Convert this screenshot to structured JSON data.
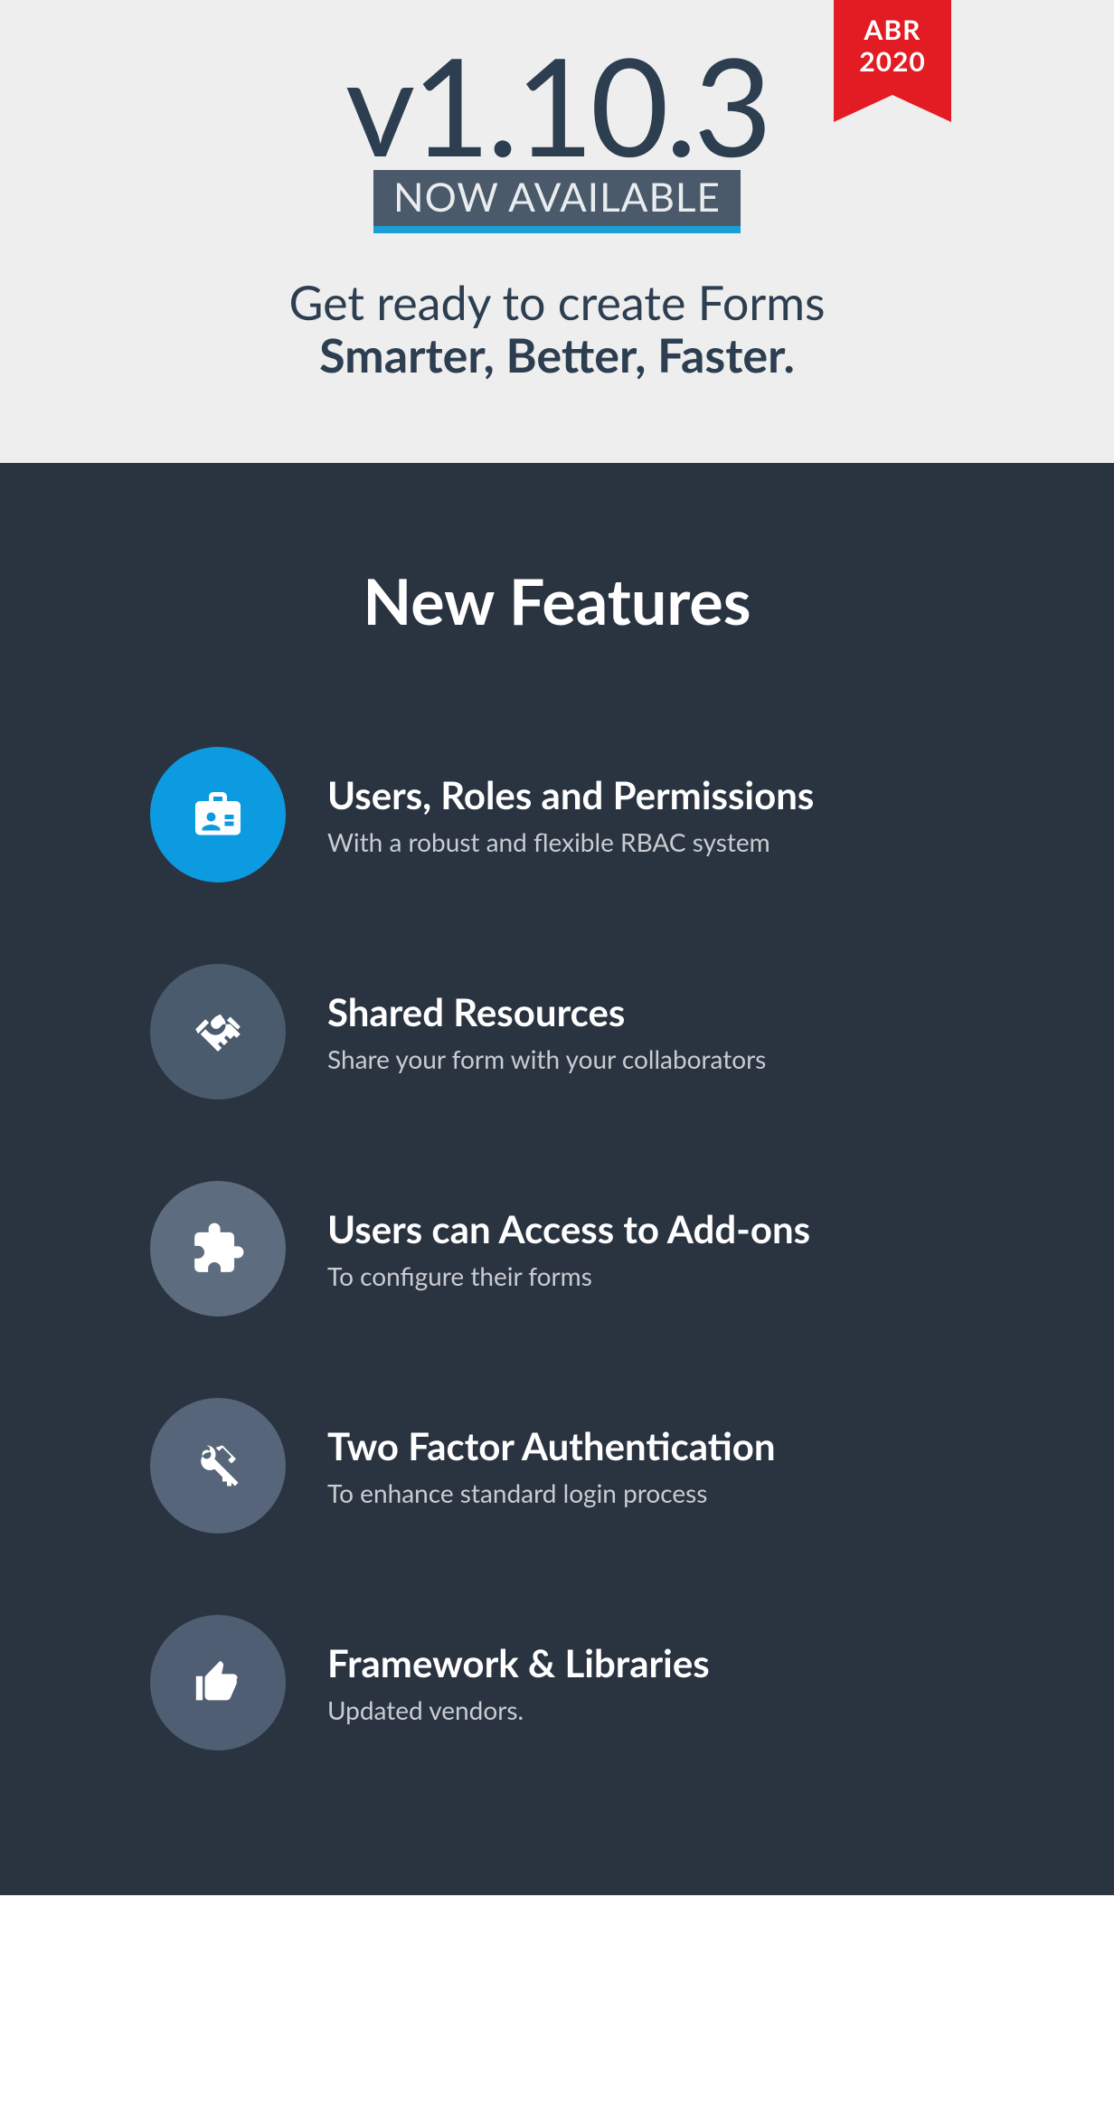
{
  "ribbon": {
    "line1": "ABR",
    "line2": "2020"
  },
  "hero": {
    "version": "v1.10.3",
    "badge": "NOW AVAILABLE",
    "tagline_line1": "Get ready to create Forms",
    "tagline_line2": "Smarter, Better, Faster."
  },
  "features": {
    "heading": "New Features",
    "items": [
      {
        "title": "Users, Roles and Permissions",
        "desc": "With a robust and flexible RBAC system"
      },
      {
        "title": "Shared Resources",
        "desc": "Share your form with your collaborators"
      },
      {
        "title": "Users can Access to Add-ons",
        "desc": "To configure their forms"
      },
      {
        "title": "Two Factor Authentication",
        "desc": "To enhance standard login process"
      },
      {
        "title": "Framework & Libraries",
        "desc": "Updated vendors."
      }
    ]
  }
}
